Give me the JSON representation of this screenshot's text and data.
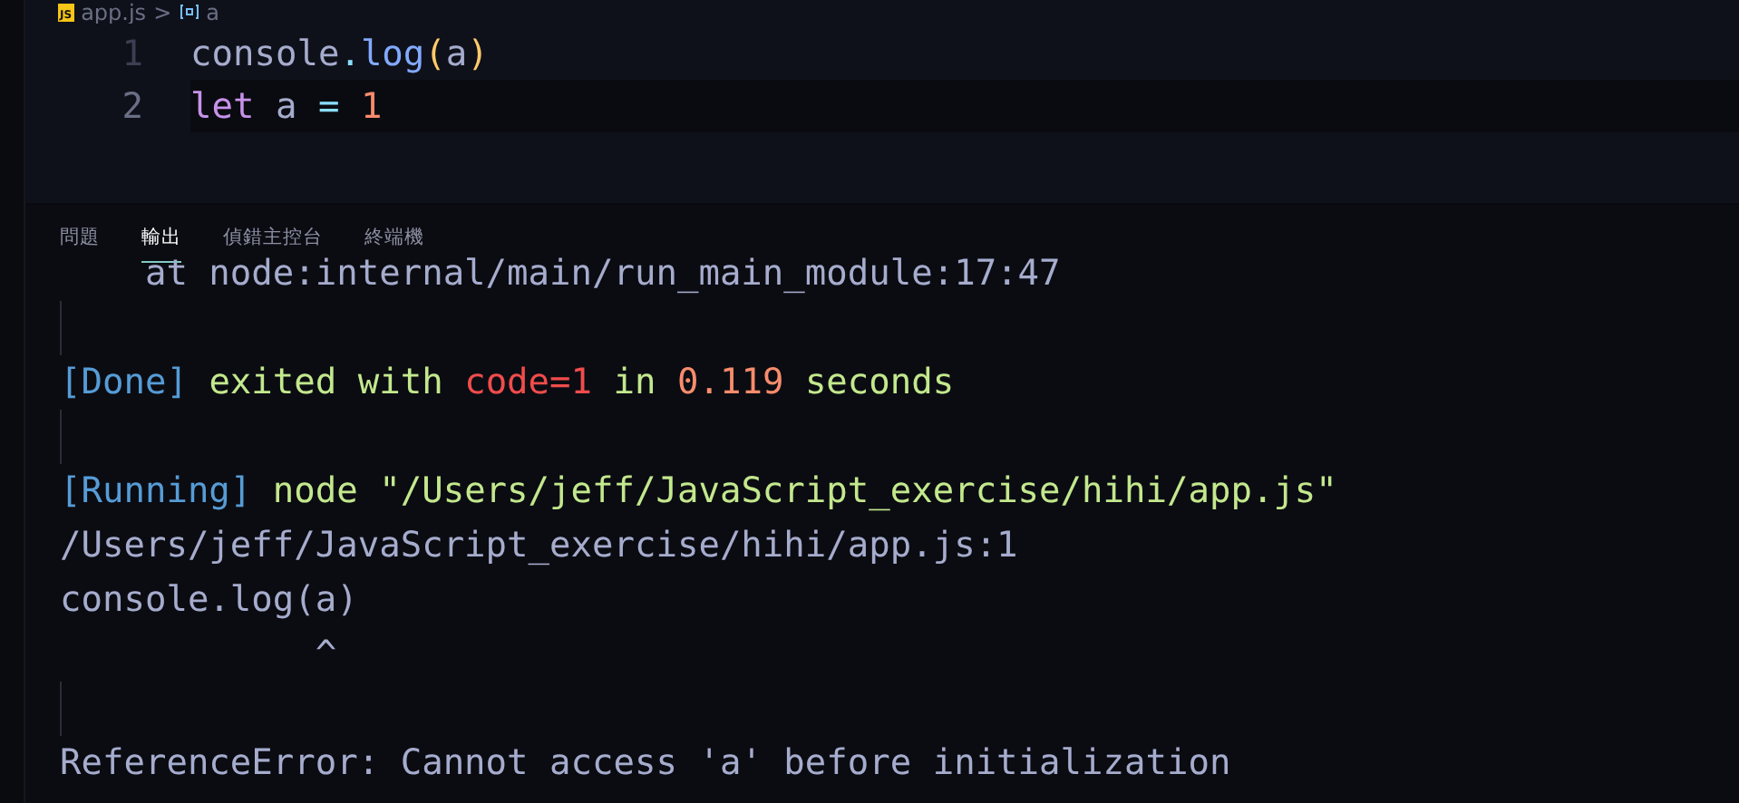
{
  "breadcrumb": {
    "file": "app.js",
    "file_badge": "JS",
    "separator": ">",
    "symbol": "a"
  },
  "editor": {
    "lines": [
      {
        "number": "1",
        "active": false,
        "tokens": [
          {
            "kind": "plain",
            "text": "console"
          },
          {
            "kind": "punct",
            "text": "."
          },
          {
            "kind": "func",
            "text": "log"
          },
          {
            "kind": "paren",
            "text": "("
          },
          {
            "kind": "plain",
            "text": "a"
          },
          {
            "kind": "paren",
            "text": ")"
          }
        ]
      },
      {
        "number": "2",
        "active": true,
        "tokens": [
          {
            "kind": "keyword",
            "text": "let"
          },
          {
            "kind": "plain",
            "text": " a "
          },
          {
            "kind": "punct",
            "text": "="
          },
          {
            "kind": "number",
            "text": " 1"
          }
        ]
      }
    ]
  },
  "panel": {
    "tabs": [
      {
        "label": "問題",
        "selected": false
      },
      {
        "label": "輸出",
        "selected": true
      },
      {
        "label": "偵錯主控台",
        "selected": false
      },
      {
        "label": "終端機",
        "selected": false
      }
    ],
    "output": [
      {
        "segments": [
          {
            "kind": "plain",
            "text": "    at node:internal/main/run_main_module:17:47"
          }
        ]
      },
      {
        "kind": "blank"
      },
      {
        "segments": [
          {
            "kind": "tag",
            "text": "[Done]"
          },
          {
            "kind": "green",
            "text": " exited with "
          },
          {
            "kind": "red",
            "text": "code=1"
          },
          {
            "kind": "green",
            "text": " in "
          },
          {
            "kind": "orange",
            "text": "0.119"
          },
          {
            "kind": "green",
            "text": " seconds"
          }
        ]
      },
      {
        "kind": "blank"
      },
      {
        "segments": [
          {
            "kind": "tag",
            "text": "[Running]"
          },
          {
            "kind": "green",
            "text": " node \"/Users/jeff/JavaScript_exercise/hihi/app.js\""
          }
        ]
      },
      {
        "segments": [
          {
            "kind": "plain",
            "text": "/Users/jeff/JavaScript_exercise/hihi/app.js:1"
          }
        ]
      },
      {
        "segments": [
          {
            "kind": "plain",
            "text": "console.log(a)"
          }
        ]
      },
      {
        "segments": [
          {
            "kind": "plain",
            "text": "            ^"
          }
        ]
      },
      {
        "kind": "blank"
      },
      {
        "segments": [
          {
            "kind": "plain",
            "text": "ReferenceError: Cannot access 'a' before initialization"
          }
        ]
      }
    ]
  }
}
